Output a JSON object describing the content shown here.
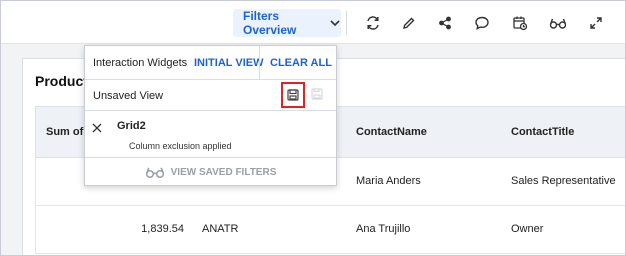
{
  "toolbar": {
    "filters_label": "Filters Overview",
    "icons": [
      "refresh-icon",
      "edit-icon",
      "share-icon",
      "comment-icon",
      "schedule-icon",
      "view-icon",
      "expand-icon"
    ]
  },
  "card": {
    "title": "Product",
    "columns": [
      "Sum of F",
      "ContactName",
      "ContactTitle"
    ],
    "rows": [
      {
        "sum": "",
        "id": "",
        "contact": "Maria Anders",
        "title": "Sales Representative"
      },
      {
        "sum": "1,839.54",
        "id": "ANATR",
        "contact": "Ana Trujillo",
        "title": "Owner"
      }
    ]
  },
  "popup": {
    "header_label": "Interaction Widgets",
    "initial_view": "INITIAL VIEW",
    "clear_all": "CLEAR ALL",
    "unsaved_label": "Unsaved View",
    "filter_name": "Grid2",
    "filter_desc": "Column exclusion applied",
    "view_saved": "VIEW SAVED FILTERS"
  },
  "colors": {
    "accent": "#1d63cf",
    "accent_bg": "#eaf2fd",
    "highlight": "#e02424"
  }
}
